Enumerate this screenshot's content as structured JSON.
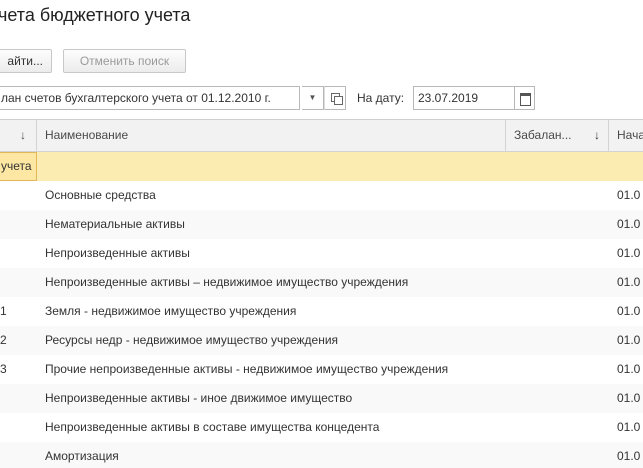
{
  "form": {
    "title": "чета бюджетного учета"
  },
  "toolbar": {
    "find_label": "айти...",
    "cancel_search_label": "Отменить поиск"
  },
  "filters": {
    "plan_value": "лан счетов бухгалтерского учета от 01.12.2010 г.",
    "date_label": "На дату:",
    "date_value": "23.07.2019"
  },
  "table": {
    "columns": [
      {
        "label": "↓"
      },
      {
        "label": "Наименование"
      },
      {
        "label": "Забалан..."
      },
      {
        "label": "Нача"
      }
    ],
    "rows": [
      {
        "code": "учета",
        "name": "",
        "offbalance": "",
        "start": ""
      },
      {
        "code": "",
        "name": "Основные средства",
        "offbalance": "",
        "start": "01.0"
      },
      {
        "code": "",
        "name": "Нематериальные активы",
        "offbalance": "",
        "start": "01.0"
      },
      {
        "code": "",
        "name": "Непроизведенные активы",
        "offbalance": "",
        "start": "01.0"
      },
      {
        "code": "",
        "name": "Непроизведенные активы – недвижимое имущество учреждения",
        "offbalance": "",
        "start": "01.0"
      },
      {
        "code": "1",
        "name": "Земля - недвижимое имущество учреждения",
        "offbalance": "",
        "start": "01.0"
      },
      {
        "code": "2",
        "name": "Ресурсы недр - недвижимое имущество учреждения",
        "offbalance": "",
        "start": "01.0"
      },
      {
        "code": "3",
        "name": "Прочие непроизведенные активы - недвижимое имущество учреждения",
        "offbalance": "",
        "start": "01.0"
      },
      {
        "code": "",
        "name": "Непроизведенные активы - иное движимое имущество",
        "offbalance": "",
        "start": "01.0"
      },
      {
        "code": "",
        "name": "Непроизведенные активы в составе имущества концедента",
        "offbalance": "",
        "start": "01.0"
      },
      {
        "code": "",
        "name": "Амортизация",
        "offbalance": "",
        "start": "01.0"
      }
    ]
  },
  "icons": {
    "sort": "arrow-down-icon",
    "dropdown": "chevron-down-icon",
    "open": "open-form-icon",
    "calendar": "calendar-icon"
  },
  "colors": {
    "selected_row": "#fbecb1",
    "selected_cell_border": "#e1b75a",
    "header_bg": "#f2f2f2"
  }
}
